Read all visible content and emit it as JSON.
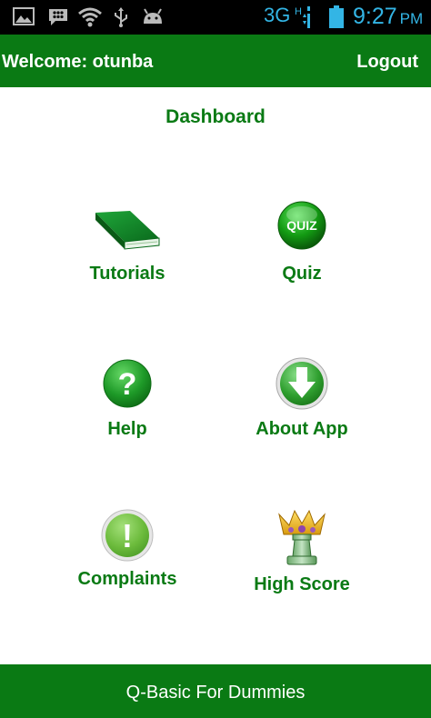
{
  "status_bar": {
    "network": "3G",
    "time": "9:27",
    "ampm": "PM",
    "icons": [
      "gallery-icon",
      "bbm-icon",
      "wifi-icon",
      "usb-icon",
      "android-icon",
      "signal-icon",
      "battery-icon"
    ],
    "accent_color": "#33b5e5"
  },
  "header": {
    "welcome": "Welcome: otunba",
    "logout": "Logout",
    "color": "#0a7a14"
  },
  "dashboard": {
    "title": "Dashboard",
    "tiles": [
      {
        "label": "Tutorials",
        "icon": "book-icon"
      },
      {
        "label": "Quiz",
        "icon": "quiz-icon",
        "icon_text": "QUIZ"
      },
      {
        "label": "Help",
        "icon": "question-icon",
        "icon_text": "?"
      },
      {
        "label": "About App",
        "icon": "download-arrow-icon"
      },
      {
        "label": "Complaints",
        "icon": "exclamation-icon",
        "icon_text": "!"
      },
      {
        "label": "High Score",
        "icon": "crown-trophy-icon"
      }
    ]
  },
  "footer": {
    "text": "Q-Basic For Dummies"
  }
}
